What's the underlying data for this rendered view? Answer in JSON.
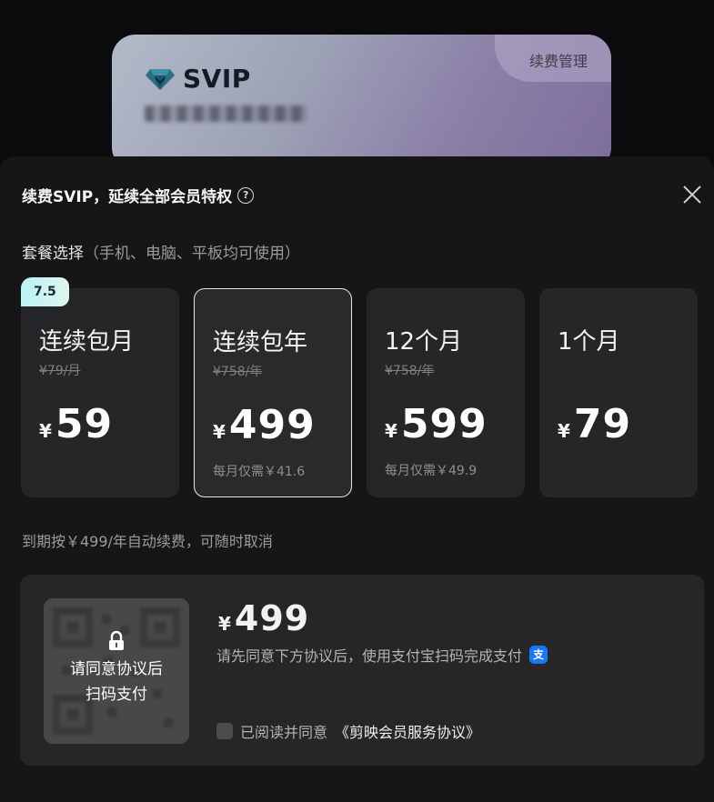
{
  "card": {
    "logo_text": "SVIP",
    "manage_label": "续费管理"
  },
  "dialog": {
    "title": "续费SVIP，延续全部会员特权",
    "help_icon": "question-circle",
    "close_icon": "close"
  },
  "plans_section": {
    "label": "套餐选择",
    "sublabel": "（手机、电脑、平板均可使用）"
  },
  "plans": [
    {
      "name": "连续包月",
      "original_price": "¥79/月",
      "currency": "¥",
      "price": "59",
      "monthly_note": "",
      "badge": "7.5折",
      "selected": false
    },
    {
      "name": "连续包年",
      "original_price": "¥758/年",
      "currency": "¥",
      "price": "499",
      "monthly_note": "每月仅需￥41.6",
      "badge": "",
      "selected": true
    },
    {
      "name": "12个月",
      "original_price": "¥758/年",
      "currency": "¥",
      "price": "599",
      "monthly_note": "每月仅需￥49.9",
      "badge": "",
      "selected": false
    },
    {
      "name": "1个月",
      "original_price": "",
      "currency": "¥",
      "price": "79",
      "monthly_note": "",
      "badge": "",
      "selected": false
    }
  ],
  "renew_note": "到期按￥499/年自动续费，可随时取消",
  "payment": {
    "qr_locked_line1": "请同意协议后",
    "qr_locked_line2": "扫码支付",
    "currency": "¥",
    "amount": "499",
    "instruction": "请先同意下方协议后，使用支付宝扫码完成支付",
    "alipay_icon": "支",
    "agree_text": "已阅读并同意",
    "agreement_link": "《剪映会员服务协议》",
    "agreed": false
  },
  "colors": {
    "sheet_bg": "#161617",
    "card_bg": "#262628",
    "badge_gradient_start": "#b9f2f7",
    "alipay_blue": "#1677ff"
  }
}
